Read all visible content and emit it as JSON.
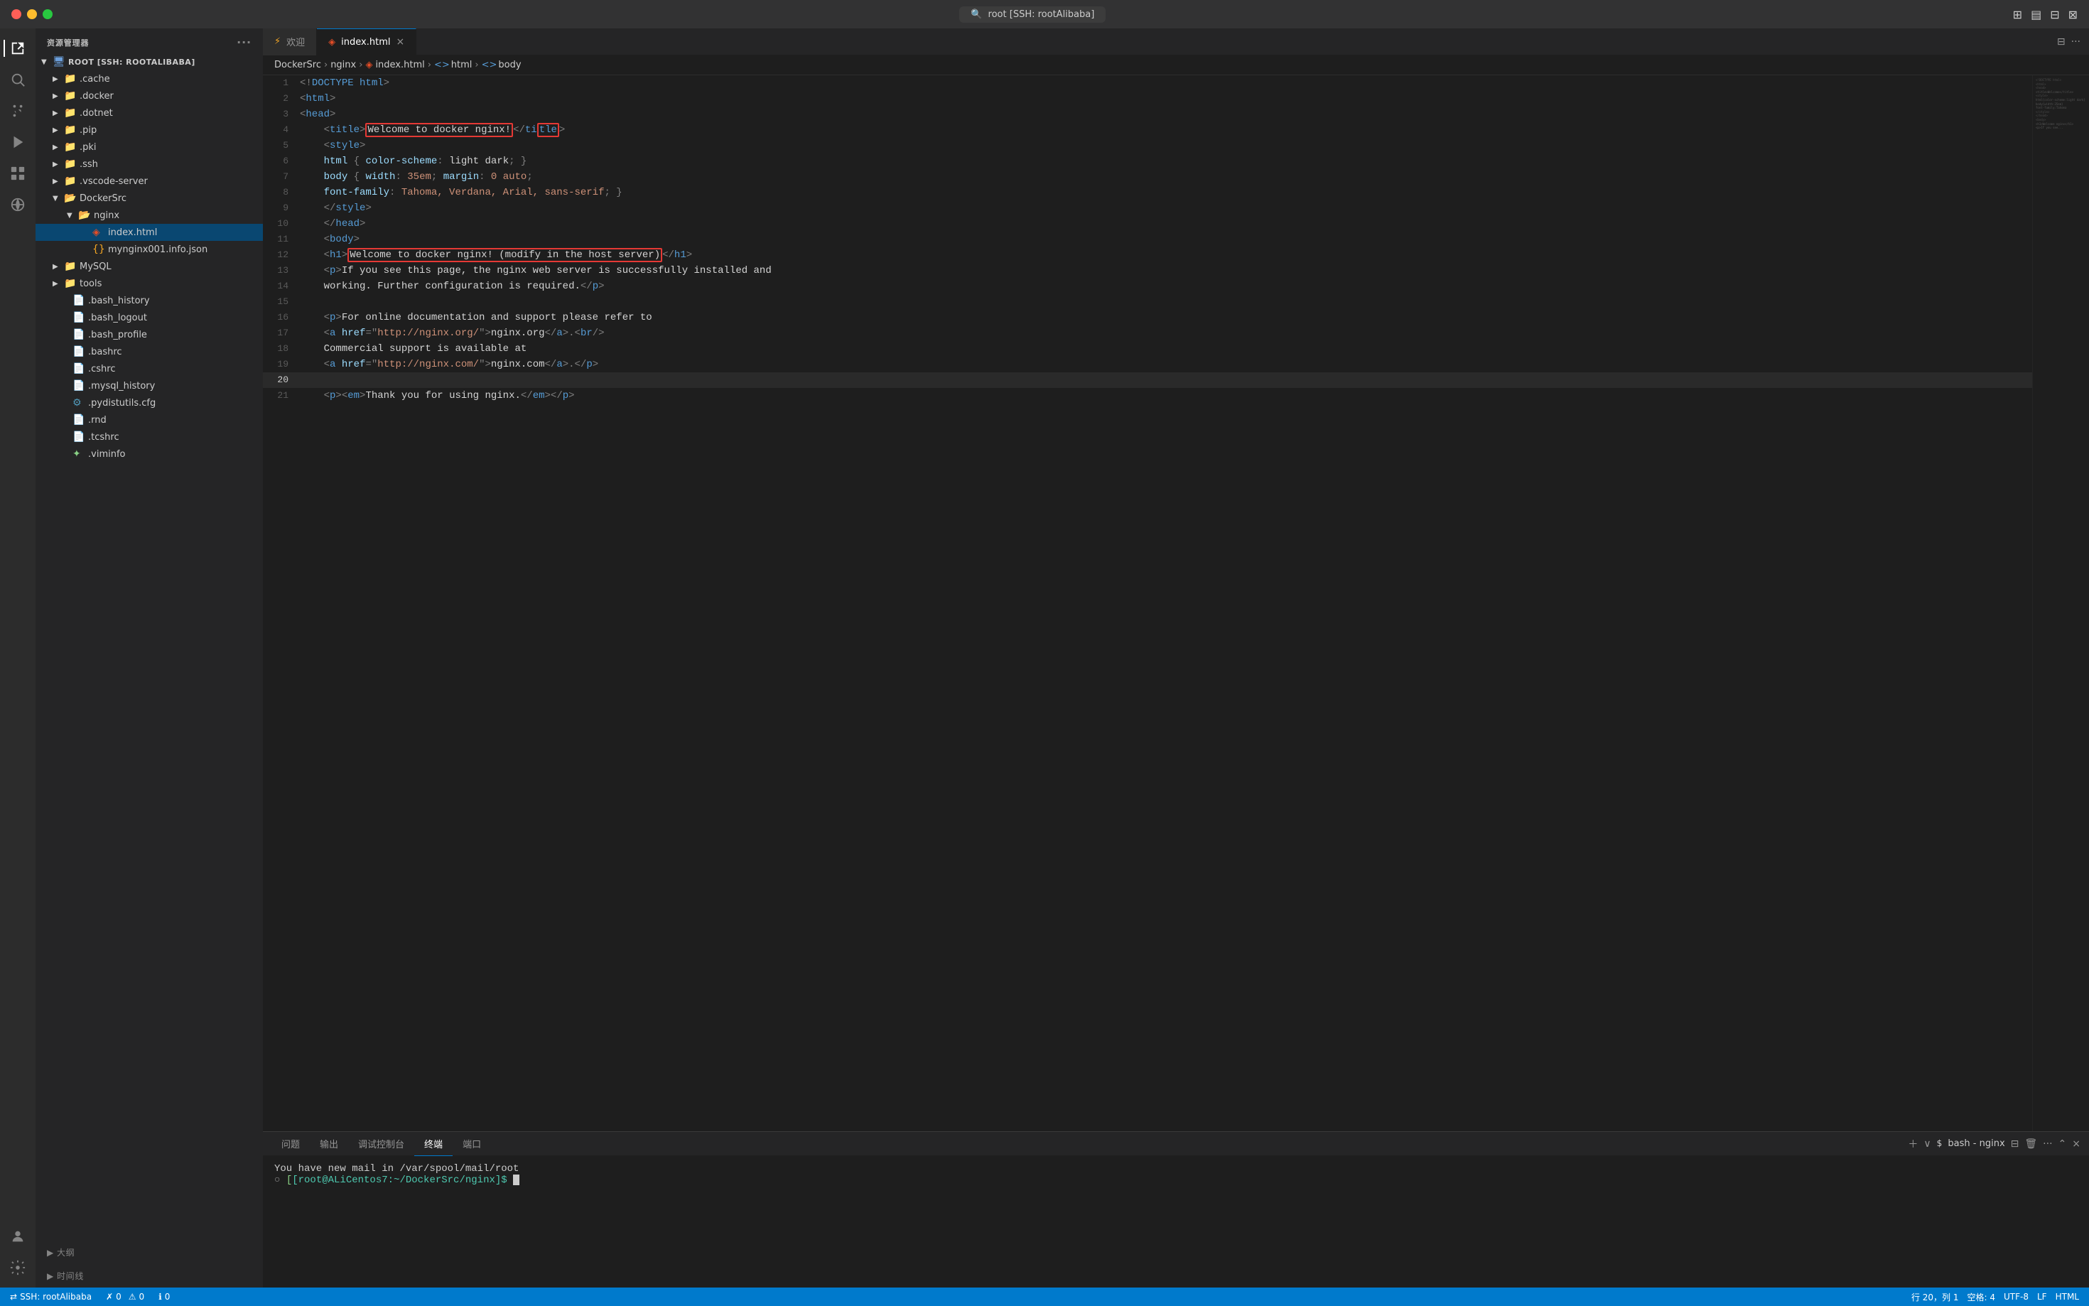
{
  "titlebar": {
    "title": "root [SSH: rootAlibaba]",
    "search_placeholder": "root [SSH: rootAlibaba]"
  },
  "sidebar": {
    "header": "资源管理器",
    "root_label": "ROOT [SSH: ROOTALIBABA]",
    "items": [
      {
        "id": "cache",
        "label": ".cache",
        "type": "folder",
        "depth": 1,
        "expanded": false
      },
      {
        "id": "docker",
        "label": ".docker",
        "type": "folder",
        "depth": 1,
        "expanded": false
      },
      {
        "id": "dotnet",
        "label": ".dotnet",
        "type": "folder",
        "depth": 1,
        "expanded": false
      },
      {
        "id": "pip",
        "label": ".pip",
        "type": "folder",
        "depth": 1,
        "expanded": false
      },
      {
        "id": "pki",
        "label": ".pki",
        "type": "folder",
        "depth": 1,
        "expanded": false
      },
      {
        "id": "ssh",
        "label": ".ssh",
        "type": "folder",
        "depth": 1,
        "expanded": false
      },
      {
        "id": "vscode-server",
        "label": ".vscode-server",
        "type": "folder",
        "depth": 1,
        "expanded": false
      },
      {
        "id": "dockersrc",
        "label": "DockerSrc",
        "type": "folder-open",
        "depth": 1,
        "expanded": true
      },
      {
        "id": "nginx",
        "label": "nginx",
        "type": "folder-open",
        "depth": 2,
        "expanded": true
      },
      {
        "id": "indexhtml",
        "label": "index.html",
        "type": "html",
        "depth": 3,
        "selected": true
      },
      {
        "id": "mynginx",
        "label": "mynginx001.info.json",
        "type": "json",
        "depth": 3
      },
      {
        "id": "mysql",
        "label": "MySQL",
        "type": "folder",
        "depth": 1,
        "expanded": false
      },
      {
        "id": "tools",
        "label": "tools",
        "type": "folder",
        "depth": 1,
        "expanded": false
      },
      {
        "id": "bash_history",
        "label": ".bash_history",
        "type": "text",
        "depth": 1
      },
      {
        "id": "bash_logout",
        "label": ".bash_logout",
        "type": "text",
        "depth": 1
      },
      {
        "id": "bash_profile",
        "label": ".bash_profile",
        "type": "text",
        "depth": 1
      },
      {
        "id": "bashrc",
        "label": ".bashrc",
        "type": "text",
        "depth": 1
      },
      {
        "id": "cshrc",
        "label": ".cshrc",
        "type": "text",
        "depth": 1
      },
      {
        "id": "mysql_history",
        "label": ".mysql_history",
        "type": "text",
        "depth": 1
      },
      {
        "id": "pydistutils",
        "label": ".pydistutils.cfg",
        "type": "settings",
        "depth": 1
      },
      {
        "id": "rnd",
        "label": ".rnd",
        "type": "text",
        "depth": 1
      },
      {
        "id": "tcshrc",
        "label": ".tcshrc",
        "type": "text",
        "depth": 1
      },
      {
        "id": "viminfo",
        "label": ".viminfo",
        "type": "vim",
        "depth": 1
      }
    ],
    "outline_label": "大纲",
    "timeline_label": "时间线"
  },
  "tabs": [
    {
      "id": "welcome",
      "label": "欢迎",
      "icon": "⚡",
      "active": false,
      "closeable": false
    },
    {
      "id": "indexhtml",
      "label": "index.html",
      "icon": "🔴",
      "active": true,
      "closeable": true
    }
  ],
  "breadcrumb": [
    {
      "label": "DockerSrc"
    },
    {
      "label": "nginx"
    },
    {
      "label": "index.html",
      "icon": "html"
    },
    {
      "label": "html"
    },
    {
      "label": "body"
    }
  ],
  "code_lines": [
    {
      "num": 1,
      "content": "<!DOCTYPE html>"
    },
    {
      "num": 2,
      "content": "<html>"
    },
    {
      "num": 3,
      "content": "<head>"
    },
    {
      "num": 4,
      "content": "    <title>Welcome to docker nginx!</title>",
      "highlight": "title"
    },
    {
      "num": 5,
      "content": "    <style>"
    },
    {
      "num": 6,
      "content": "    html { color-scheme: light dark; }"
    },
    {
      "num": 7,
      "content": "    body { width: 35em; margin: 0 auto;"
    },
    {
      "num": 8,
      "content": "    font-family: Tahoma, Verdana, Arial, sans-serif; }"
    },
    {
      "num": 9,
      "content": "    </style>"
    },
    {
      "num": 10,
      "content": "    </head>"
    },
    {
      "num": 11,
      "content": "    <body>"
    },
    {
      "num": 12,
      "content": "    <h1>Welcome to docker nginx! (modify in the host server)</h1>",
      "highlight": "h1"
    },
    {
      "num": 13,
      "content": "    <p>If you see this page, the nginx web server is successfully installed and"
    },
    {
      "num": 14,
      "content": "    working. Further configuration is required.</p>"
    },
    {
      "num": 15,
      "content": ""
    },
    {
      "num": 16,
      "content": "    <p>For online documentation and support please refer to"
    },
    {
      "num": 17,
      "content": "    <a href=\"http://nginx.org/\">nginx.org</a>.<br/>"
    },
    {
      "num": 18,
      "content": "    Commercial support is available at"
    },
    {
      "num": 19,
      "content": "    <a href=\"http://nginx.com/\">nginx.com</a>.</p>"
    },
    {
      "num": 20,
      "content": ""
    },
    {
      "num": 21,
      "content": "    <p><em>Thank you for using nginx.</em></p>"
    }
  ],
  "terminal": {
    "tabs": [
      {
        "id": "problem",
        "label": "问题"
      },
      {
        "id": "output",
        "label": "输出"
      },
      {
        "id": "debug",
        "label": "调试控制台"
      },
      {
        "id": "terminal",
        "label": "终端",
        "active": true
      },
      {
        "id": "port",
        "label": "端口"
      }
    ],
    "terminal_name": "bash - nginx",
    "line1": "You have new mail in /var/spool/mail/root",
    "line2": "[root@ALiCentos7:~/DockerSrc/nginx]$ "
  },
  "status_bar": {
    "ssh_label": "SSH: rootAlibaba",
    "errors": "0",
    "warnings": "0",
    "info": "0",
    "position": "行 20，列 1",
    "spaces": "空格: 4",
    "encoding": "UTF-8",
    "line_ending": "LF",
    "language": "HTML"
  }
}
